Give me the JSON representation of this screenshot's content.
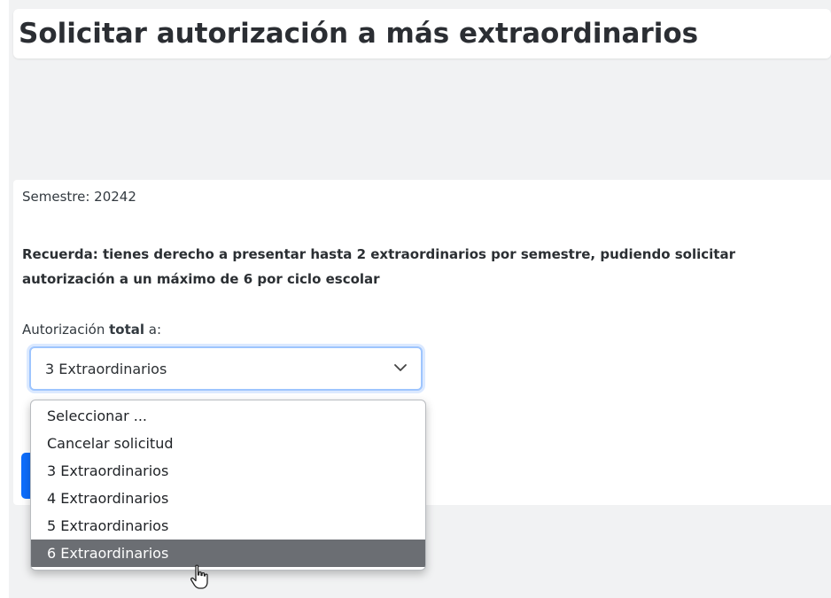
{
  "header": {
    "title": "Solicitar autorización a más extraordinarios"
  },
  "form": {
    "semester_label": "Semestre: 20242",
    "reminder": "Recuerda: tienes derecho a presentar hasta 2 extraordinarios por semestre, pudiendo solicitar autorización a un máximo de 6 por ciclo escolar",
    "authorization_label_prefix": "Autorización ",
    "authorization_label_bold": "total",
    "authorization_label_suffix": " a:",
    "select": {
      "current_value": "3 Extraordinarios",
      "options": [
        "Seleccionar ...",
        "Cancelar solicitud",
        "3 Extraordinarios",
        "4 Extraordinarios",
        "5 Extraordinarios",
        "6 Extraordinarios"
      ],
      "highlighted_option": "6 Extraordinarios"
    }
  },
  "icons": {
    "select_chevron": "chevron-down-icon",
    "mouse_cursor": "cursor-pointer-icon"
  },
  "colors": {
    "focus_border": "#9ec5fe",
    "primary_button": "#0d6efd",
    "highlighted_option": "#6b6e73",
    "background": "#f1f2f3"
  }
}
